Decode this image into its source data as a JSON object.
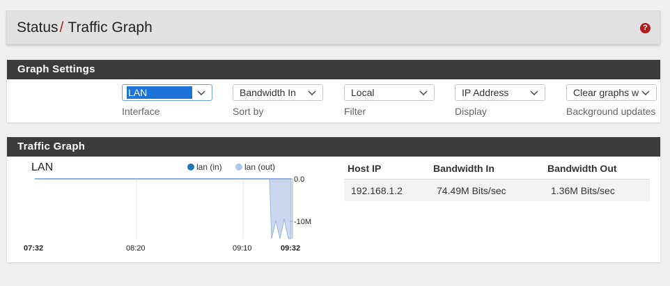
{
  "header": {
    "crumb_parent": "Status",
    "separator": "/",
    "crumb_current": "Traffic Graph",
    "help_icon_glyph": "?"
  },
  "settings": {
    "heading": "Graph Settings",
    "interface": {
      "value": "LAN",
      "label": "Interface"
    },
    "sort_by": {
      "value": "Bandwidth In",
      "label": "Sort by"
    },
    "filter": {
      "value": "Local",
      "label": "Filter"
    },
    "display": {
      "value": "IP Address",
      "label": "Display"
    },
    "background": {
      "value": "Clear graphs w",
      "label": "Background updates"
    }
  },
  "graph": {
    "heading": "Traffic Graph",
    "chart_data": {
      "type": "area",
      "title": "LAN",
      "x_tick_labels": [
        "07:32",
        "08:20",
        "09:10",
        "09:32"
      ],
      "y_tick_labels": [
        "0.0",
        "-10M"
      ],
      "ylim": [
        -15,
        0
      ],
      "grid": true,
      "legend_position": "top",
      "series": [
        {
          "name": "lan (in)",
          "color": "#1f77b4"
        },
        {
          "name": "lan (out)",
          "color": "#aec7e8"
        }
      ]
    }
  },
  "hosts": {
    "columns": [
      "Host IP",
      "Bandwidth In",
      "Bandwidth Out"
    ],
    "rows": [
      {
        "ip": "192.168.1.2",
        "in": "74.49M Bits/sec",
        "out": "1.36M Bits/sec"
      }
    ]
  },
  "colors": {
    "panel_heading_bg": "#3c3c3c",
    "accent_red": "#b71c1c",
    "select_highlight": "#1e73d6"
  }
}
